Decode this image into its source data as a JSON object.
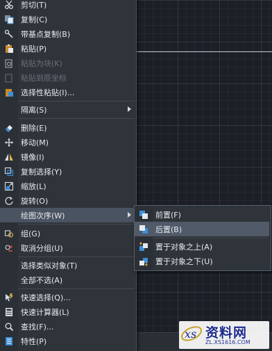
{
  "context_menu": {
    "items": [
      {
        "label": "剪切(T)",
        "icon": "scissors-icon",
        "disabled": false
      },
      {
        "label": "复制(C)",
        "icon": "copy-icon",
        "disabled": false
      },
      {
        "label": "带基点复制(B)",
        "icon": "copy-with-basepoint-icon",
        "disabled": false
      },
      {
        "label": "粘贴(P)",
        "icon": "paste-icon",
        "disabled": false
      },
      {
        "label": "粘贴为块(K)",
        "icon": "paste-as-block-icon",
        "disabled": true
      },
      {
        "label": "粘贴到原坐标",
        "icon": "paste-to-original-coords-icon",
        "disabled": true
      },
      {
        "label": "选择性粘贴(I)...",
        "icon": "paste-special-icon",
        "disabled": false
      },
      {
        "label": "隔离(S)",
        "icon": "",
        "disabled": false,
        "submenu": true
      },
      {
        "label": "删除(E)",
        "icon": "eraser-icon",
        "disabled": false
      },
      {
        "label": "移动(M)",
        "icon": "move-icon",
        "disabled": false
      },
      {
        "label": "镜像(I)",
        "icon": "mirror-icon",
        "disabled": false
      },
      {
        "label": "复制选择(Y)",
        "icon": "copy-selection-icon",
        "disabled": false
      },
      {
        "label": "缩放(L)",
        "icon": "scale-icon",
        "disabled": false
      },
      {
        "label": "旋转(O)",
        "icon": "rotate-icon",
        "disabled": false
      },
      {
        "label": "绘图次序(W)",
        "icon": "",
        "disabled": false,
        "submenu": true
      },
      {
        "label": "组(G)",
        "icon": "group-icon",
        "disabled": false
      },
      {
        "label": "取消分组(U)",
        "icon": "ungroup-icon",
        "disabled": false
      },
      {
        "label": "选择类似对象(T)",
        "icon": "",
        "disabled": false
      },
      {
        "label": "全部不选(A)",
        "icon": "",
        "disabled": false
      },
      {
        "label": "快速选择(Q)...",
        "icon": "quick-select-icon",
        "disabled": false
      },
      {
        "label": "快速计算器(L)",
        "icon": "calculator-icon",
        "disabled": false
      },
      {
        "label": "查找(F)...",
        "icon": "find-icon",
        "disabled": false
      },
      {
        "label": "特性(P)",
        "icon": "properties-icon",
        "disabled": false
      }
    ]
  },
  "draw_order_submenu": {
    "items": [
      {
        "label": "前置(F)",
        "icon": "bring-to-front-icon"
      },
      {
        "label": "后置(B)",
        "icon": "send-to-back-icon"
      },
      {
        "label": "置于对象之上(A)",
        "icon": "bring-above-objects-icon"
      },
      {
        "label": "置于对象之下(U)",
        "icon": "send-under-objects-icon"
      }
    ]
  },
  "watermark": {
    "title": "资料网",
    "url": "ZL.XS1616.COM"
  },
  "colors": {
    "menu_bg": "#2f333a",
    "highlight": "#4a5361",
    "disabled_text": "#6b7079",
    "icon_blue": "#3a8fd9",
    "watermark_blue": "#1a2a8a"
  }
}
